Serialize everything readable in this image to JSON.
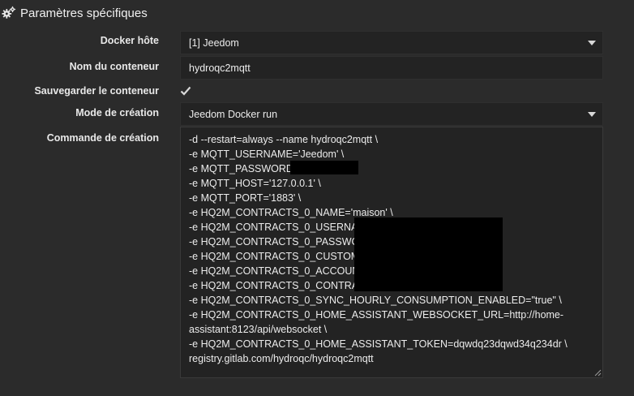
{
  "section": {
    "title": "Paramètres spécifiques",
    "icon": "gears-icon"
  },
  "fields": {
    "docker_host": {
      "label": "Docker hôte",
      "value": "[1] Jeedom"
    },
    "container_name": {
      "label": "Nom du conteneur",
      "value": "hydroqc2mqtt"
    },
    "save_container": {
      "label": "Sauvegarder le conteneur",
      "checked": true
    },
    "creation_mode": {
      "label": "Mode de création",
      "value": "Jeedom Docker run"
    },
    "creation_command": {
      "label": "Commande de création",
      "lines": [
        "-d --restart=always --name hydroqc2mqtt \\",
        "-e MQTT_USERNAME='Jeedom' \\",
        "-e MQTT_PASSWORD=",
        "-e MQTT_HOST='127.0.0.1' \\",
        "-e MQTT_PORT='1883' \\",
        "-e HQ2M_CONTRACTS_0_NAME='maison' \\",
        "-e HQ2M_CONTRACTS_0_USERNAM",
        "-e HQ2M_CONTRACTS_0_PASSWOR",
        "-e HQ2M_CONTRACTS_0_CUSTOME",
        "-e HQ2M_CONTRACTS_0_ACCOUNT",
        "-e HQ2M_CONTRACTS_0_CONTRACT",
        "-e HQ2M_CONTRACTS_0_SYNC_HOURLY_CONSUMPTION_ENABLED=\"true\" \\",
        "-e HQ2M_CONTRACTS_0_HOME_ASSISTANT_WEBSOCKET_URL=http://home-assistant:8123/api/websocket \\",
        "-e HQ2M_CONTRACTS_0_HOME_ASSISTANT_TOKEN=dqwdq23dqwd34q234dr \\",
        "registry.gitlab.com/hydroqc/hydroqc2mqtt"
      ]
    }
  },
  "colors": {
    "background": "#2b2b2b",
    "field": "#232323",
    "text": "#e6e6e6",
    "redaction": "#000000"
  }
}
